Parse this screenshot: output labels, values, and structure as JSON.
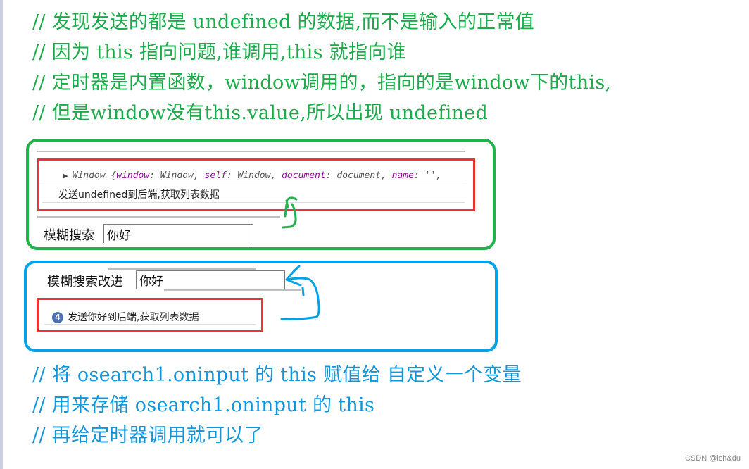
{
  "top_comments": [
    "// 发现发送的都是 undefined 的数据,而不是输入的正常值",
    "// 因为 this 指向问题,谁调用,this 就指向谁",
    "// 定时器是内置函数，window调用的，指向的是window下的this,",
    "// 但是window没有this.value,所以出现 undefined"
  ],
  "panel_before": {
    "console_object": {
      "prefix": "Window {",
      "entries": [
        {
          "key": "window",
          "value": "Window"
        },
        {
          "key": "self",
          "value": "Window"
        },
        {
          "key": "document",
          "value": "document"
        },
        {
          "key": "name",
          "value": "''"
        }
      ]
    },
    "log_message": "发送undefined到后端,获取列表数据",
    "search_label": "模糊搜索",
    "search_value": "你好"
  },
  "panel_after": {
    "search_label": "模糊搜索改进",
    "search_value": "你好",
    "log_count": "4",
    "log_message": "发送你好到后端,获取列表数据"
  },
  "bottom_comments": [
    "// 将 osearch1.oninput 的 this 赋值给 自定义一个变量",
    "// 用来存储 osearch1.oninput 的 this",
    "// 再给定时器调用就可以了"
  ],
  "watermark": "CSDN @ich&du",
  "colors": {
    "green_comment": "#1aac4a",
    "blue_comment": "#1296db",
    "green_frame": "#22b14c",
    "blue_frame": "#00a2e8",
    "highlight_red": "#ee3333"
  }
}
